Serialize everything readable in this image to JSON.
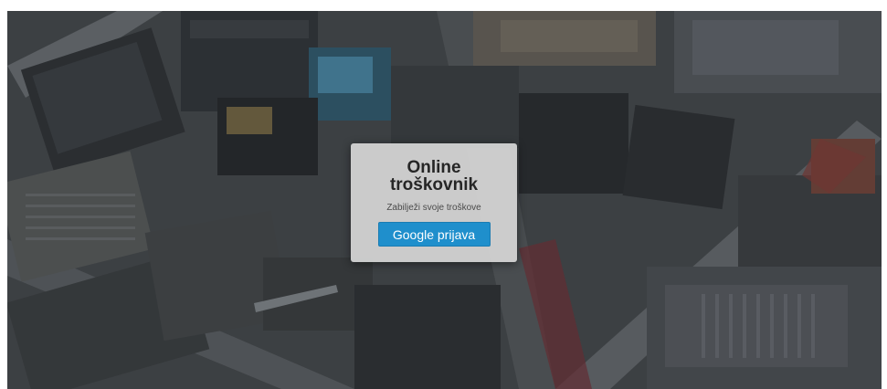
{
  "login_card": {
    "title_line1": "Online",
    "title_line2": "troškovnik",
    "subtitle": "Zabilježi svoje troškove",
    "login_button_label": "Google prijava"
  },
  "colors": {
    "button_bg": "#1f8fcc",
    "button_text": "#ffffff",
    "card_bg": "#d6d6d6",
    "title_text": "#262626"
  }
}
